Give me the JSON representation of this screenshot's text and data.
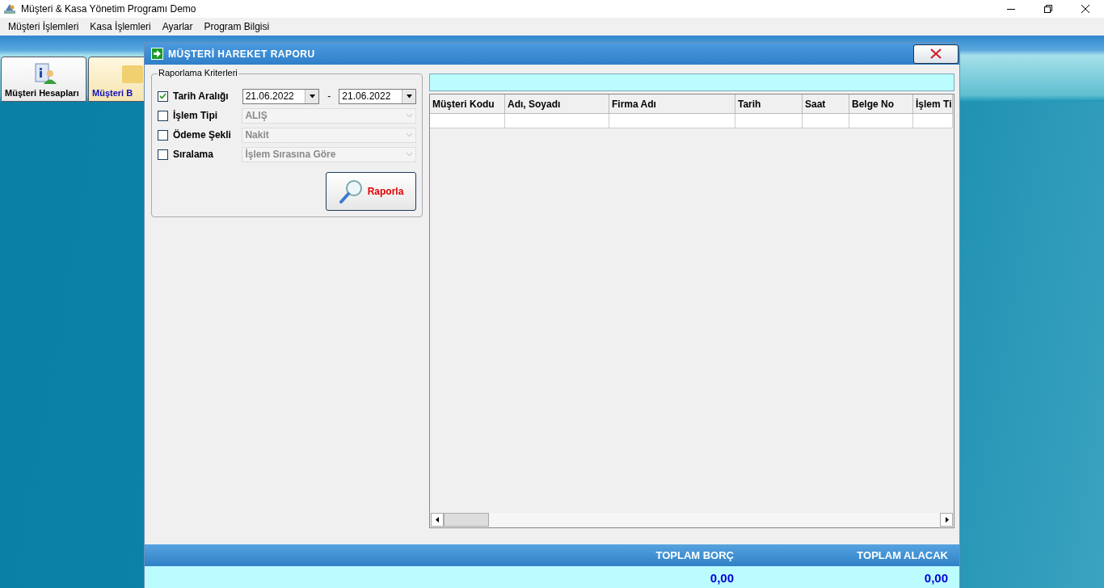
{
  "window": {
    "title": "Müşteri & Kasa Yönetim Programı Demo"
  },
  "menu": [
    "Müşteri İşlemleri",
    "Kasa İşlemleri",
    "Ayarlar",
    "Program Bilgisi"
  ],
  "toolbar": [
    {
      "label": "Müşteri Hesapları",
      "selected": false
    },
    {
      "label": "Müşteri B",
      "selected": true
    }
  ],
  "dialog": {
    "title": "MÜŞTERİ HAREKET RAPORU",
    "criteria": {
      "legend": "Raporlama Kriterleri",
      "rows": [
        {
          "kind": "daterange",
          "label": "Tarih Aralığı",
          "checked": true,
          "from": "21.06.2022",
          "separator": "-",
          "to": "21.06.2022"
        },
        {
          "kind": "combo",
          "label": "İşlem Tipi",
          "checked": false,
          "value": "ALIŞ"
        },
        {
          "kind": "combo",
          "label": "Ödeme Şekli",
          "checked": false,
          "value": "Nakit"
        },
        {
          "kind": "combo",
          "label": "Sıralama",
          "checked": false,
          "value": "İşlem Sırasına Göre"
        }
      ]
    },
    "report_button": "Raporla",
    "grid": {
      "columns": [
        "Müşteri Kodu",
        "Adı, Soyadı",
        "Firma Adı",
        "Tarih",
        "Saat",
        "Belge No",
        "İşlem Ti"
      ]
    },
    "footer": {
      "totals": [
        {
          "label": "TOPLAM BORÇ",
          "value": "0,00"
        },
        {
          "label": "TOPLAM ALACAK",
          "value": "0,00"
        }
      ]
    }
  }
}
